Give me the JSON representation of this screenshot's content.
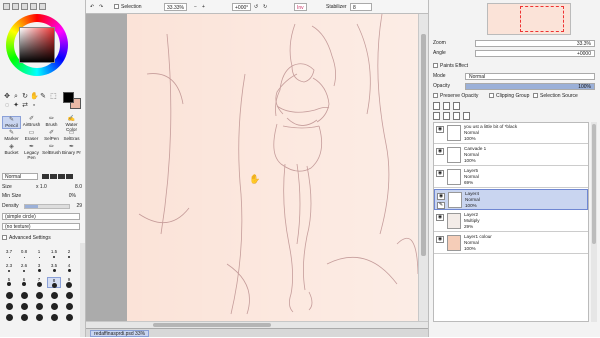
{
  "colors": {
    "foreground": "#000000",
    "background": "#e9b9a6",
    "canvas_paper": "#fbe3d8",
    "selected_layer": "#c9d5f0"
  },
  "toolbar": {
    "selection_label": "Selection",
    "zoom": "33.33%",
    "rotation": "+000°",
    "mode": "Inv",
    "stabilizer_label": "Stabilizer",
    "stabilizer_value": "8"
  },
  "tools": {
    "row1": [
      "Pencil",
      "AirBrush",
      "Brush",
      "Water Color"
    ],
    "row2": [
      "Marker",
      "Eraser",
      "SelPen",
      "SelEras"
    ],
    "row3": [
      "Bucket",
      "Legacy Pen",
      "SelBrush",
      "Binary Pr"
    ]
  },
  "brush": {
    "mode": "Normal",
    "size_label": "Size",
    "size_mult": "x 1.0",
    "size_value": "8.0",
    "min_size_label": "Min Size",
    "min_size_value": "0%",
    "min_size_fraction": 0,
    "density_label": "Density",
    "density_value": "29",
    "density_fraction": 0.29,
    "shape": "(simple circle)",
    "texture": "(no texture)",
    "advanced": "Advanced Settings"
  },
  "brush_sizes": [
    [
      "3.7",
      "0.8",
      "1",
      "1.5",
      "2"
    ],
    [
      "2.3",
      "2.6",
      "3",
      "3.5",
      "4"
    ],
    [
      "5",
      "6",
      "7",
      "8",
      "9"
    ]
  ],
  "navigator": {
    "zoom_label": "Zoom",
    "zoom_value": "33.3%",
    "angle_label": "Angle",
    "angle_value": "+0000"
  },
  "layer_panel": {
    "paints_effect": "Paints Effect",
    "mode_label": "Mode",
    "mode_value": "Normal",
    "opacity_label": "Opacity",
    "opacity_value": "100%",
    "preserve_opacity": "Preserve Opacity",
    "clipping_group": "Clipping Group",
    "selection_source": "Selection Source"
  },
  "layers": [
    {
      "name": "you ust a little bit of *black",
      "mode": "Normal",
      "opacity": "100%",
      "selected": false
    },
    {
      "name": "Canvade 1",
      "mode": "Normal",
      "opacity": "100%",
      "selected": false
    },
    {
      "name": "Layer5",
      "mode": "Normal",
      "opacity": "69%",
      "selected": false
    },
    {
      "name": "Layer4",
      "mode": "Normal",
      "opacity": "100%",
      "selected": true
    },
    {
      "name": "Layer2",
      "mode": "Multiply",
      "opacity": "29%",
      "selected": false
    },
    {
      "name": "Layer1 colour",
      "mode": "Normal",
      "opacity": "100%",
      "selected": false
    }
  ],
  "document_tab": "redaffinasprdi.psd  33%"
}
